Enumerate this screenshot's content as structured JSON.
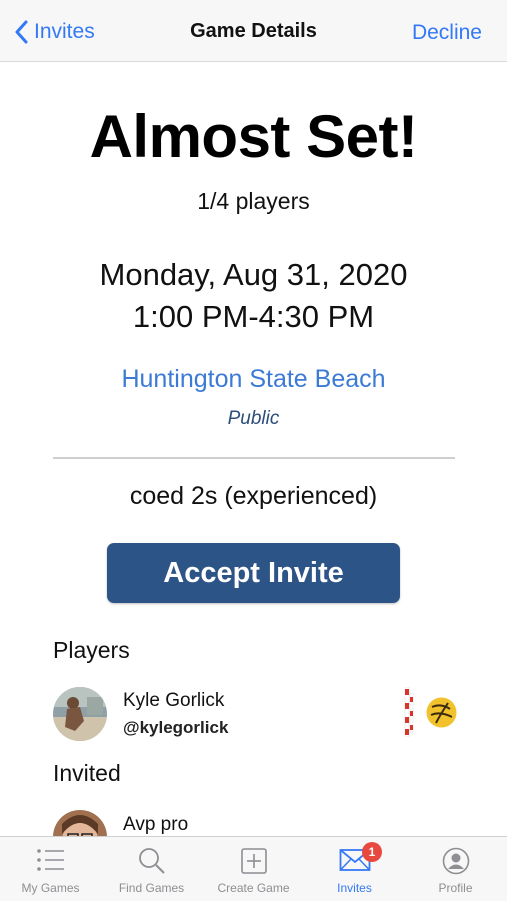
{
  "nav": {
    "back_label": "Invites",
    "title": "Game Details",
    "right_label": "Decline"
  },
  "game": {
    "status": "Almost Set!",
    "player_count": "1/4 players",
    "date": "Monday, Aug 31, 2020",
    "time": "1:00 PM-4:30 PM",
    "location": "Huntington State Beach",
    "visibility": "Public",
    "type": "coed 2s (experienced)",
    "accept_label": "Accept Invite"
  },
  "players": {
    "title": "Players",
    "items": [
      {
        "name": "Kyle Gorlick",
        "handle": "@kylegorlick"
      }
    ]
  },
  "invited": {
    "title": "Invited",
    "items": [
      {
        "name": "Avp pro",
        "handle": ""
      }
    ]
  },
  "tabbar": {
    "items": [
      {
        "label": "My Games",
        "icon": "list-icon",
        "active": false
      },
      {
        "label": "Find Games",
        "icon": "search-icon",
        "active": false
      },
      {
        "label": "Create Game",
        "icon": "plus-square-icon",
        "active": false
      },
      {
        "label": "Invites",
        "icon": "envelope-icon",
        "active": true,
        "badge": "1"
      },
      {
        "label": "Profile",
        "icon": "person-circle-icon",
        "active": false
      }
    ]
  },
  "colors": {
    "accent": "#3478f6",
    "button": "#2d5486",
    "badge": "#e8493f",
    "location": "#3b7bd6"
  }
}
